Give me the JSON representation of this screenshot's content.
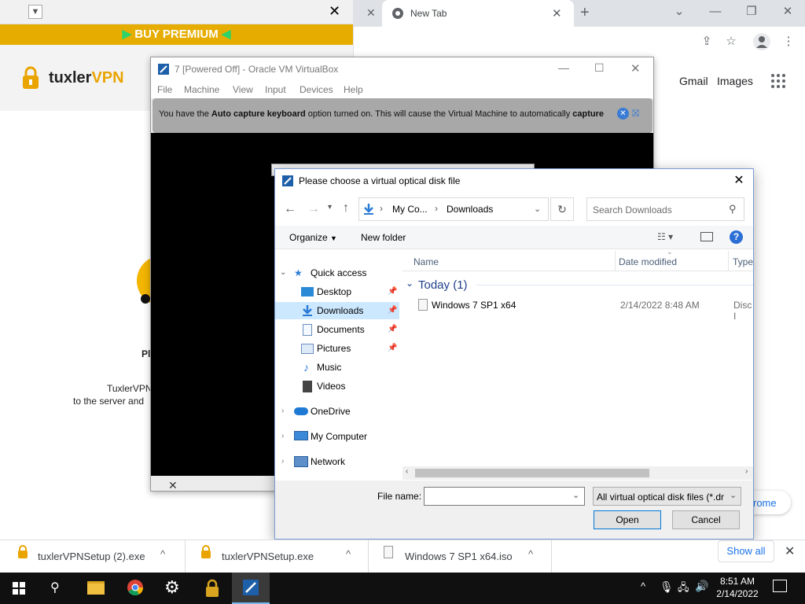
{
  "browser": {
    "tab_title": "New Tab",
    "google_links": [
      "Gmail",
      "Images"
    ],
    "chrome_partial": "rome"
  },
  "tuxler": {
    "premium_label": "BUY PREMIUM",
    "logo_main": "tuxler",
    "logo_vpn": "VPN",
    "heading_partial": "Pl",
    "body_line1": "TuxlerVPN",
    "body_line2": "to the server and"
  },
  "virtualbox": {
    "title": "7 [Powered Off] - Oracle VM VirtualBox",
    "menu": [
      "File",
      "Machine",
      "View",
      "Input",
      "Devices",
      "Help"
    ],
    "notice_prefix": "You have the ",
    "notice_bold1": "Auto capture keyboard",
    "notice_middle": " option turned on. This will cause the Virtual Machine to automatically ",
    "notice_bold2": "capture"
  },
  "dialog": {
    "title": "Please choose a virtual optical disk file",
    "breadcrumb": [
      "My Co...",
      "Downloads"
    ],
    "search_placeholder": "Search Downloads",
    "organize_label": "Organize",
    "new_folder_label": "New folder",
    "nav": [
      {
        "label": "Quick access",
        "icon": "star-icon"
      },
      {
        "label": "Desktop",
        "icon": "desktop-icon",
        "pinned": true
      },
      {
        "label": "Downloads",
        "icon": "downloads-icon",
        "pinned": true,
        "selected": true
      },
      {
        "label": "Documents",
        "icon": "documents-icon",
        "pinned": true
      },
      {
        "label": "Pictures",
        "icon": "pictures-icon",
        "pinned": true
      },
      {
        "label": "Music",
        "icon": "music-icon"
      },
      {
        "label": "Videos",
        "icon": "videos-icon"
      },
      {
        "label": "OneDrive",
        "icon": "onedrive-icon"
      },
      {
        "label": "My Computer",
        "icon": "computer-icon"
      },
      {
        "label": "Network",
        "icon": "network-icon"
      }
    ],
    "columns": [
      "Name",
      "Date modified",
      "Type"
    ],
    "group_label": "Today (1)",
    "files": [
      {
        "name": "Windows 7 SP1 x64",
        "date": "2/14/2022 8:48 AM",
        "type": "Disc I"
      }
    ],
    "filename_label": "File name:",
    "filename_value": "",
    "filter_value": "All virtual optical disk files (*.dr",
    "open_label": "Open",
    "cancel_label": "Cancel"
  },
  "downloads": {
    "items": [
      "tuxlerVPNSetup (2).exe",
      "tuxlerVPNSetup.exe",
      "Windows 7 SP1 x64.iso"
    ],
    "show_all": "Show all"
  },
  "taskbar": {
    "time": "8:51 AM",
    "date": "2/14/2022"
  }
}
